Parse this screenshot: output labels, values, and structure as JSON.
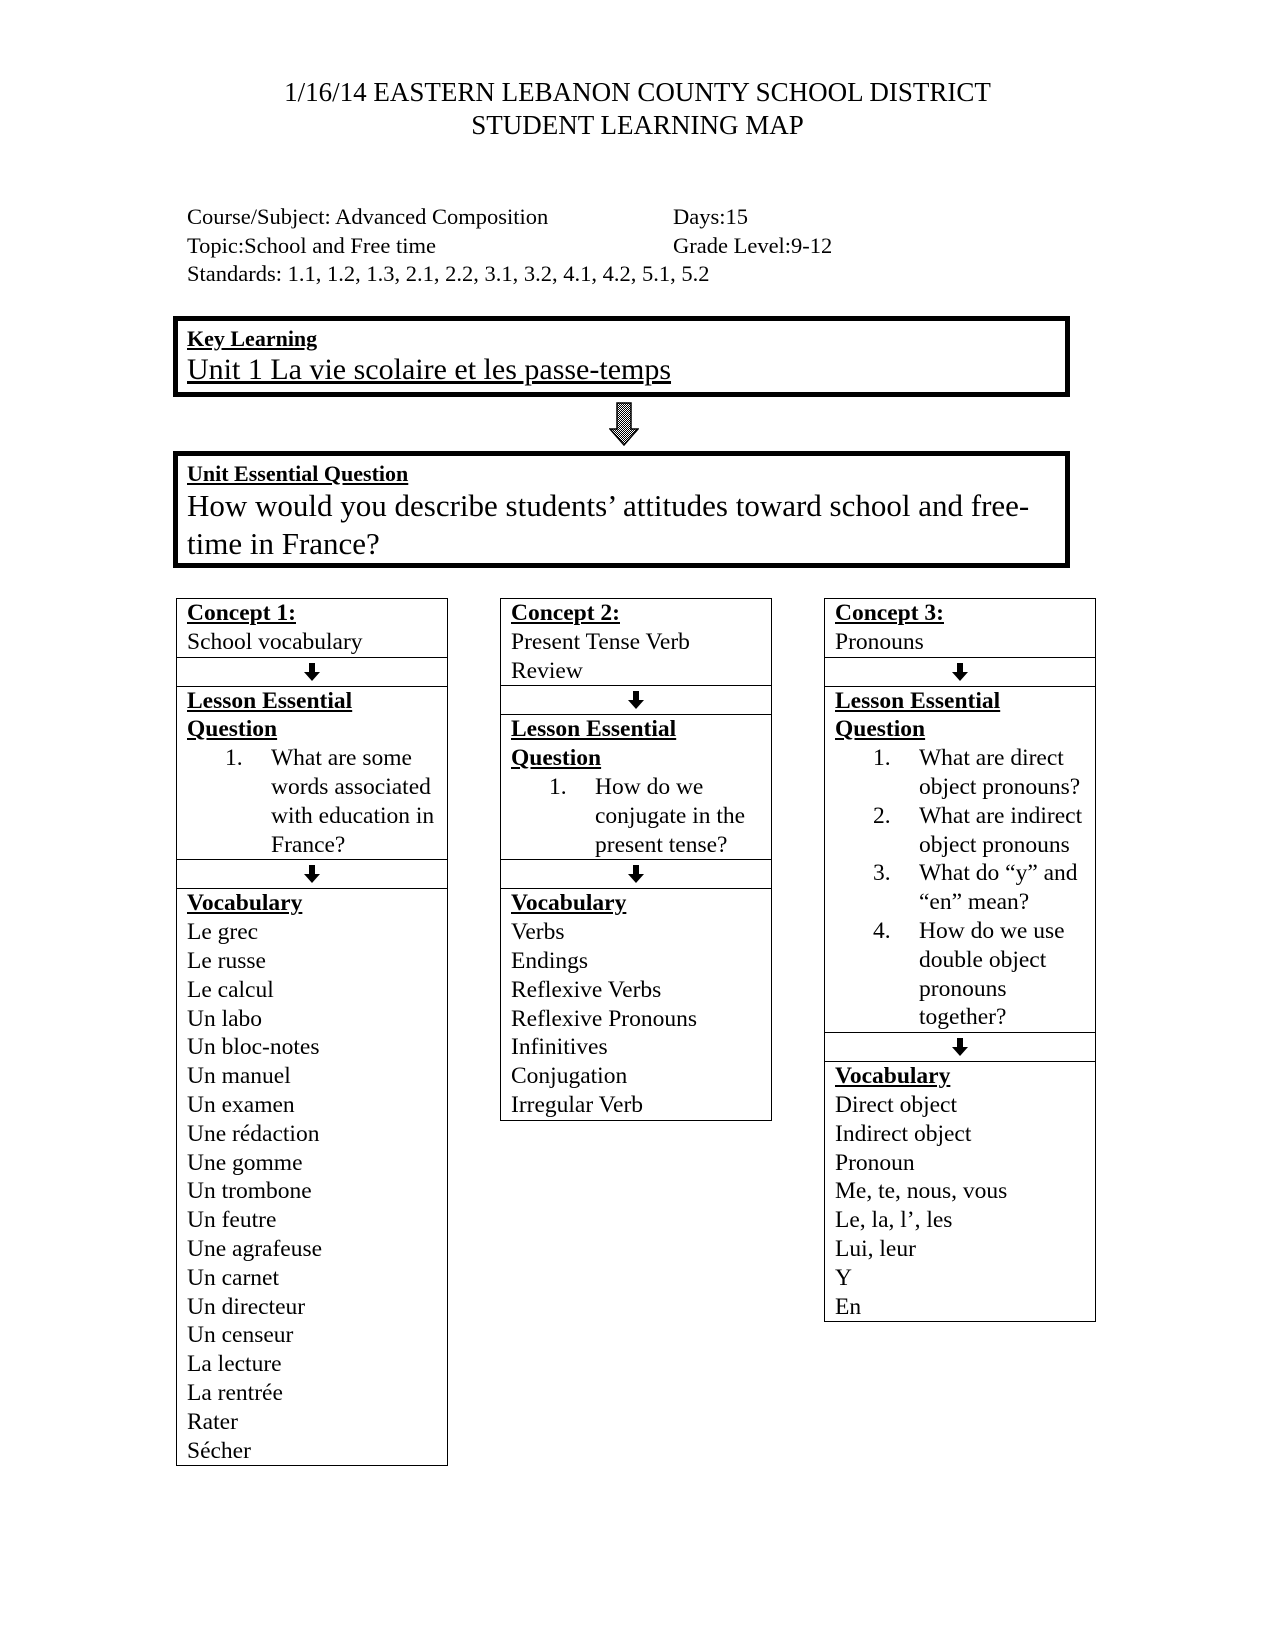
{
  "header": {
    "title_line1": "1/16/14 EASTERN LEBANON COUNTY SCHOOL DISTRICT",
    "title_line2": "STUDENT LEARNING MAP"
  },
  "meta": {
    "course": "Course/Subject: Advanced Composition",
    "days": "Days:15",
    "topic": "Topic:School and Free time",
    "grade": "Grade Level:9-12",
    "standards": "Standards: 1.1, 1.2, 1.3, 2.1, 2.2, 3.1, 3.2, 4.1, 4.2, 5.1, 5.2"
  },
  "key_learning": {
    "label": "Key Learning",
    "text": "Unit 1 La vie scolaire et les passe-temps"
  },
  "unit_question": {
    "label": "Unit Essential Question",
    "text": "How would you describe students’ attitudes toward school and free-time in France?"
  },
  "concepts": [
    {
      "label": "Concept 1:",
      "name": "School vocabulary",
      "leq_label": "Lesson Essential Question",
      "questions": [
        "What are some words associated with education in France?"
      ],
      "vocab_label": "Vocabulary",
      "vocab": [
        "Le grec",
        "Le russe",
        "Le calcul",
        "Un labo",
        "Un bloc-notes",
        "Un manuel",
        "Un examen",
        "Une rédaction",
        "Une gomme",
        "Un trombone",
        "Un feutre",
        "Une agrafeuse",
        "Un carnet",
        "Un directeur",
        "Un censeur",
        "La lecture",
        "La rentrée",
        "Rater",
        "Sécher"
      ]
    },
    {
      "label": "Concept 2:",
      "name": "Present Tense Verb Review",
      "leq_label": "Lesson Essential Question",
      "questions": [
        "How do we conjugate in the present tense?"
      ],
      "vocab_label": "Vocabulary",
      "vocab": [
        "Verbs",
        "Endings",
        "Reflexive Verbs",
        "Reflexive Pronouns",
        "Infinitives",
        "Conjugation",
        "Irregular Verb"
      ]
    },
    {
      "label": "Concept 3:",
      "name": "Pronouns",
      "leq_label": "Lesson Essential Question",
      "questions": [
        "What are direct object pronouns?",
        "What are indirect object pronouns",
        "What do “y” and “en” mean?",
        "How do we use double object pronouns together?"
      ],
      "vocab_label": "Vocabulary",
      "vocab": [
        "Direct object",
        "Indirect object",
        "Pronoun",
        "Me, te, nous, vous",
        "Le, la, l’, les",
        "Lui, leur",
        "Y",
        "En"
      ]
    }
  ]
}
